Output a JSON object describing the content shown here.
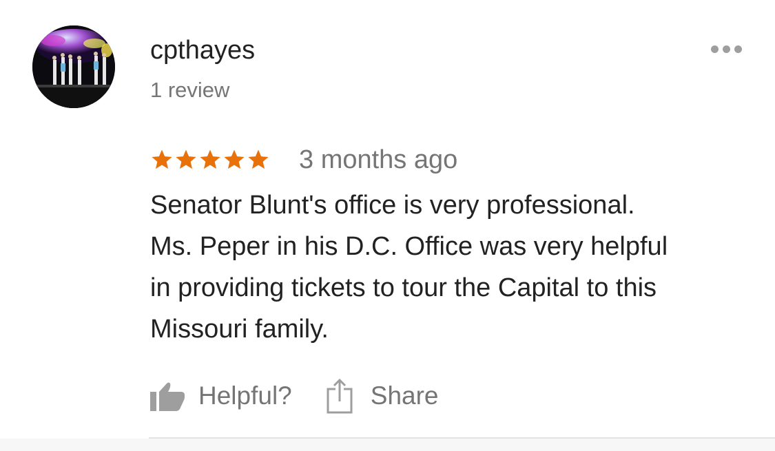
{
  "review": {
    "user": {
      "name": "cpthayes",
      "review_count": "1 review",
      "avatar": "concert-stage-photo"
    },
    "rating": 5,
    "rating_max": 5,
    "timestamp": "3 months ago",
    "text_lines": [
      "Senator Blunt's office is very professional.",
      "Ms. Peper in his D.C. Office was very helpful",
      "in providing tickets to tour the Capital to this",
      "Missouri family."
    ],
    "actions": {
      "helpful_label": "Helpful?",
      "share_label": "Share"
    }
  },
  "icons": {
    "more": "more-horizontal-icon",
    "star": "star-icon",
    "helpful": "thumbs-up-icon",
    "share": "share-icon"
  },
  "colors": {
    "star": "#e8710a",
    "primary_text": "#222222",
    "secondary_text": "#757575",
    "icon_gray": "#9e9e9e",
    "divider": "#e3e3e3"
  }
}
